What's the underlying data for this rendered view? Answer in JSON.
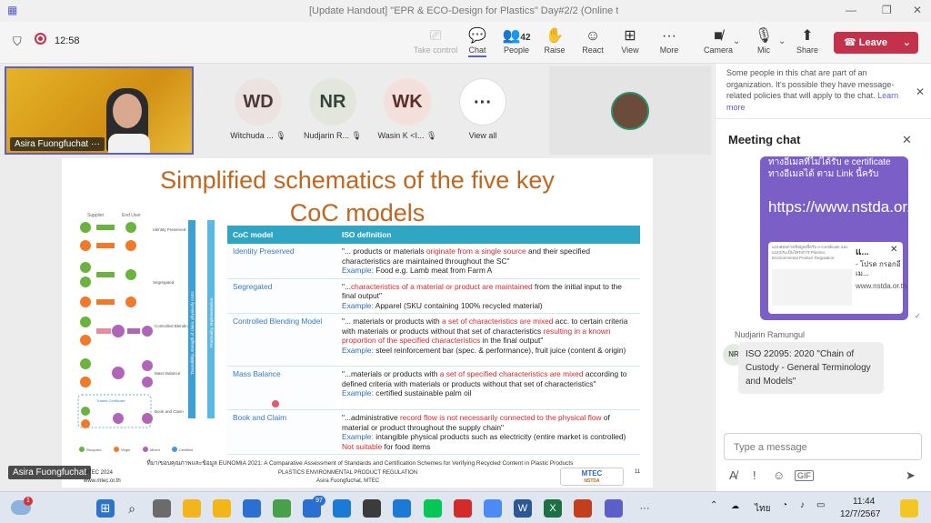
{
  "window": {
    "title": "[Update Handout] \"EPR & ECO-Design for Plastics\" Day#2/2 (Online tr...",
    "min_icon": "minimize-icon",
    "max_icon": "maximize-icon",
    "close_icon": "close-icon"
  },
  "meeting": {
    "timer": "12:58"
  },
  "toolbar": {
    "take_control": "Take control",
    "chat": "Chat",
    "people": "People",
    "people_count": "42",
    "raise": "Raise",
    "react": "React",
    "view": "View",
    "more": "More",
    "camera": "Camera",
    "mic": "Mic",
    "share": "Share",
    "leave": "Leave"
  },
  "participants": {
    "self": {
      "name": "Asira Fuongfuchat"
    },
    "tiles": [
      {
        "initials": "WD",
        "name": "Witchuda ...",
        "color": "#ece3e0"
      },
      {
        "initials": "NR",
        "name": "Nudjarin R...",
        "color": "#e2e6dd"
      },
      {
        "initials": "WK",
        "name": "Wasin K <I...",
        "color": "#f3dfdc"
      }
    ],
    "view_all": "View all",
    "presenter_tag": "Asira Fuongfuchat"
  },
  "slide": {
    "title_line1": "Simplified schematics of the five key",
    "title_line2": "CoC models",
    "table": {
      "headers": [
        "CoC model",
        "ISO definition"
      ],
      "rows": [
        {
          "model": "Identity Preserved",
          "p1": "\"... products or materials ",
          "hl": "originate from a single source",
          "p2": " and their specified characteristics are maintained throughout the SC\"",
          "ex_label": "Example: ",
          "ex": "Food e.g. Lamb meat from Farm A"
        },
        {
          "model": "Segregated",
          "p1": "\"...",
          "hl": "characteristics of a material or product are maintained",
          "p2": " from the initial input to the final output\"",
          "ex_label": "Example: ",
          "ex": "Apparel (SKU containing 100% recycled material)"
        },
        {
          "model": "Controlled Blending Model",
          "p1": "\"... materials or products with ",
          "hl": "a set of characteristics are mixed",
          "p2": " acc. to certain criteria with materials or products without that set of characteristics ",
          "hl2": "resulting in a known proportion of the specified characteristics",
          "p3": " in the final output\"",
          "ex_label": "Example: ",
          "ex": "steel reinforcement bar (spec. & performance), fruit juice (content & origin)"
        },
        {
          "model": "Mass Balance",
          "p1": "\"...materials or products with ",
          "hl": "a set of specified characteristics are mixed",
          "p2": " according to defined criteria with materials or products without that set of characteristics\"",
          "ex_label": "Example: ",
          "ex": "certified sustainable palm oil"
        },
        {
          "model": "Book and Claim",
          "p1": "\"...administrative ",
          "hl": "record flow is not necessarily connected to the physical flow",
          "p2": " of material or product throughout the supply chain\"",
          "ex_label": "Example: ",
          "ex": "intangible physical products such as electricity (entire market is controlled) ",
          "ex_hl": "Not suitable",
          "ex2": " for food items"
        }
      ]
    },
    "diagram": {
      "supplier": "Supplier",
      "end_user": "End User",
      "labels": [
        "Identity Preserved",
        "Segregated",
        "Controlled Blending",
        "Mass Balance",
        "Book and Claim"
      ],
      "traded_cert": "Traded Certificate",
      "legend": [
        "Recycled",
        "Virgin",
        "Mixed",
        "Certified"
      ],
      "axis1": "Traceability, strength of claim, physically costs",
      "axis2": "Practicality, implementation"
    },
    "source": "ที่มา/ขอบคุณภาพและข้อมูล EUNOMIA 2021: A Comparative Assessment of Standards and Certification Schemes for Verifying Recycled Content in Plastic Products",
    "footer_left": "MTEC 2024",
    "footer_left2": "www.mtec.or.th",
    "footer_center": "PLASTICS ENVIRONMENTAL PRODUCT REGULATION",
    "footer_center2": "Asira Fuongfuchat, MTEC",
    "footer_logo": "MTEC",
    "footer_logo2": "NSTDA",
    "page": "11"
  },
  "chat": {
    "notice": "Some people in this chat are part of an organization. It's possible they have message-related policies that will apply to the chat.",
    "notice_link": "Learn more",
    "title": "Meeting chat",
    "card_text_top": "ทางอีเมลที่ไม่ได้รับ e certificate ทางอีเมลได้ ตาม Link นี้ครับ",
    "card_link": "https://www.nstda.or.th/r/iZ95D",
    "preview_title": "แ...",
    "preview_sub": "- โปรด กรอกอีเม...",
    "preview_url": "www.nstda.or.th",
    "preview_doc": "แบบสอบถามข้อมูลเพื่อรับ e-Certificate และแบบประเมินโครงการ Plastics Environmental Product Regulation",
    "sender": "Nudjarin Ramungul",
    "sender_initials": "NR",
    "message": "ISO 22095: 2020 \"Chain of Custody - General Terminology and Models\"",
    "placeholder": "Type a message"
  },
  "taskbar": {
    "lang": "ไทย",
    "time": "11:44",
    "date": "12/7/2567",
    "mail_badge": "97",
    "weather_badge": "1"
  }
}
